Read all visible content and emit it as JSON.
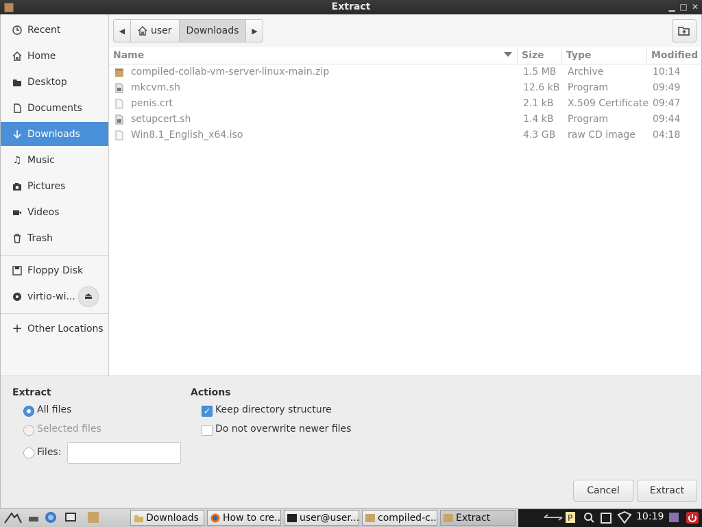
{
  "window": {
    "title": "Extract"
  },
  "sidebar": {
    "items": [
      {
        "label": "Recent",
        "icon": "clock-icon"
      },
      {
        "label": "Home",
        "icon": "home-icon"
      },
      {
        "label": "Desktop",
        "icon": "folder-icon"
      },
      {
        "label": "Documents",
        "icon": "document-icon"
      },
      {
        "label": "Downloads",
        "icon": "download-arrow-icon",
        "active": true
      },
      {
        "label": "Music",
        "icon": "music-note-icon"
      },
      {
        "label": "Pictures",
        "icon": "camera-icon"
      },
      {
        "label": "Videos",
        "icon": "film-icon"
      },
      {
        "label": "Trash",
        "icon": "trash-icon"
      },
      {
        "label": "Floppy Disk",
        "icon": "floppy-icon"
      },
      {
        "label": "virtio-wi...",
        "icon": "disc-icon"
      },
      {
        "label": "Other Locations",
        "icon": "plus-icon"
      }
    ]
  },
  "pathbar": {
    "crumbs": [
      "user",
      "Downloads"
    ]
  },
  "filelist": {
    "columns": [
      "Name",
      "Size",
      "Type",
      "Modified"
    ],
    "rows": [
      {
        "name": "compiled-collab-vm-server-linux-main.zip",
        "size": "1.5 MB",
        "type": "Archive",
        "modified": "10:14",
        "icon": "archive-icon"
      },
      {
        "name": "mkcvm.sh",
        "size": "12.6 kB",
        "type": "Program",
        "modified": "09:49",
        "icon": "script-icon"
      },
      {
        "name": "penis.crt",
        "size": "2.1 kB",
        "type": "X.509 Certificate",
        "modified": "09:47",
        "icon": "file-icon"
      },
      {
        "name": "setupcert.sh",
        "size": "1.4 kB",
        "type": "Program",
        "modified": "09:44",
        "icon": "script-icon"
      },
      {
        "name": "Win8.1_English_x64.iso",
        "size": "4.3 GB",
        "type": "raw CD image",
        "modified": "04:18",
        "icon": "file-icon"
      }
    ]
  },
  "extract": {
    "heading": "Extract",
    "all_files": "All files",
    "selected_files": "Selected files",
    "files_label": "Files:",
    "files_value": ""
  },
  "actions": {
    "heading": "Actions",
    "keep_structure": "Keep directory structure",
    "keep_structure_checked": true,
    "no_overwrite": "Do not overwrite newer files",
    "no_overwrite_checked": false
  },
  "buttons": {
    "cancel": "Cancel",
    "extract": "Extract"
  },
  "taskbar": {
    "tasks": [
      "Downloads",
      "How to cre...",
      "user@user...",
      "compiled-c...",
      "Extract"
    ],
    "clock": "10:19"
  },
  "colors": {
    "accent": "#4a90d9",
    "titlebar": "#2e2e2e"
  }
}
